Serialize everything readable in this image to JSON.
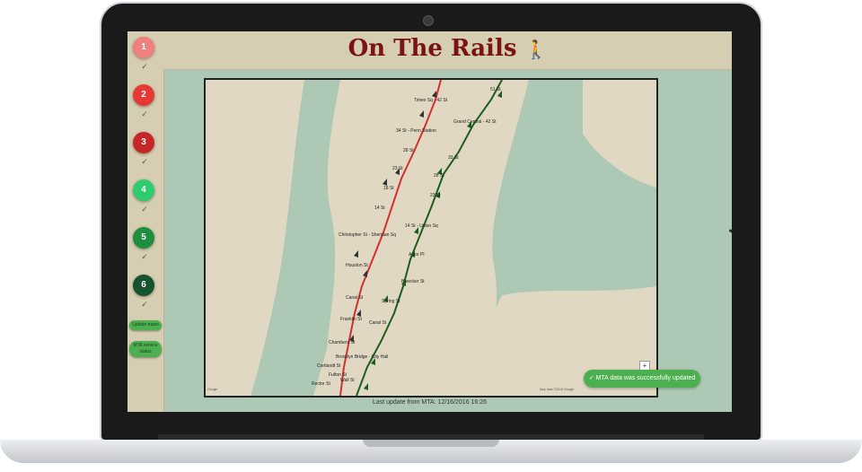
{
  "app": {
    "title": "On The Rails"
  },
  "sidebar": {
    "steps": [
      {
        "label": "1",
        "color": "#f08080"
      },
      {
        "label": "2",
        "color": "#e53935"
      },
      {
        "label": "3",
        "color": "#c62828"
      },
      {
        "label": "4",
        "color": "#2ecc71"
      },
      {
        "label": "5",
        "color": "#1e8e3e"
      },
      {
        "label": "6",
        "color": "#14532d"
      }
    ],
    "update_trains_label": "Update trains",
    "mta_status_label": "MTA service status"
  },
  "map": {
    "stations": [
      "Times Sq - 42 St",
      "51 St",
      "Grand Central - 42 St",
      "34 St - Penn Station",
      "28 St",
      "33 St",
      "23 St",
      "28 St",
      "18 St",
      "23 St",
      "14 St",
      "14 St - Union Sq",
      "Christopher St - Sheridan Sq",
      "Astor Pl",
      "Houston St",
      "Bleecker St",
      "Canal St",
      "Spring St",
      "Franklin St",
      "Canal St",
      "Chambers St",
      "Brooklyn Bridge - City Hall",
      "Cortlandt St",
      "Fulton St",
      "Rector St",
      "Wall St"
    ],
    "copyright": "Map data ©2016 Google",
    "google_label": "Google",
    "zoom_in": "+"
  },
  "status": {
    "last_update": "Last update from MTA: 12/16/2016 16:26",
    "toast": "MTA data was successfully updated"
  },
  "colors": {
    "red_line": "#d32f2f",
    "green_line": "#1b5e20",
    "water": "#adc9b5",
    "land": "#e1d8c3",
    "title": "#7a1414"
  }
}
